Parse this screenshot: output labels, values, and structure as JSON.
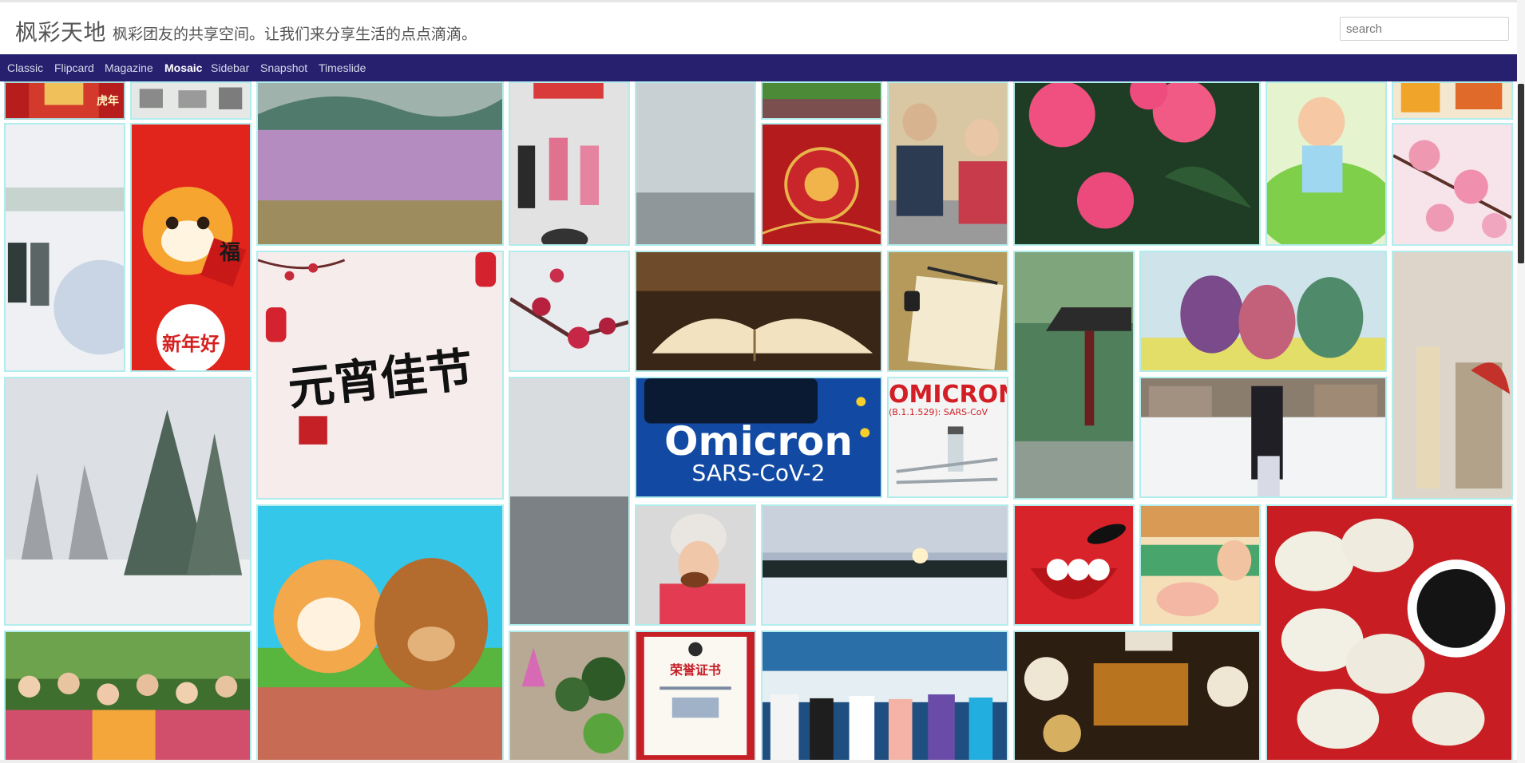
{
  "site": {
    "title": "枫彩天地",
    "description": "枫彩团友的共享空间。让我们来分享生活的点点滴滴。"
  },
  "search": {
    "placeholder": "search"
  },
  "nav": {
    "items": [
      {
        "label": "Classic"
      },
      {
        "label": "Flipcard"
      },
      {
        "label": "Magazine"
      },
      {
        "label": "Mosaic",
        "active": true
      },
      {
        "label": "Sidebar"
      },
      {
        "label": "Snapshot"
      },
      {
        "label": "Timeslide"
      }
    ]
  },
  "tile_texts": {
    "yuanxiao": "元宵佳节",
    "omicron_title": "Omicron",
    "omicron_sub": "SARS-CoV-2",
    "omicron_banner": "OMICRON",
    "omicron_banner_sub": "(B.1.1.529): SARS-CoV",
    "xinnian": "新年好",
    "fu": "福",
    "hunian": "虎年",
    "certificate": "荣誉证书"
  },
  "colors": {
    "nav_bg": "#27206f",
    "accent_red": "#d9261c"
  }
}
